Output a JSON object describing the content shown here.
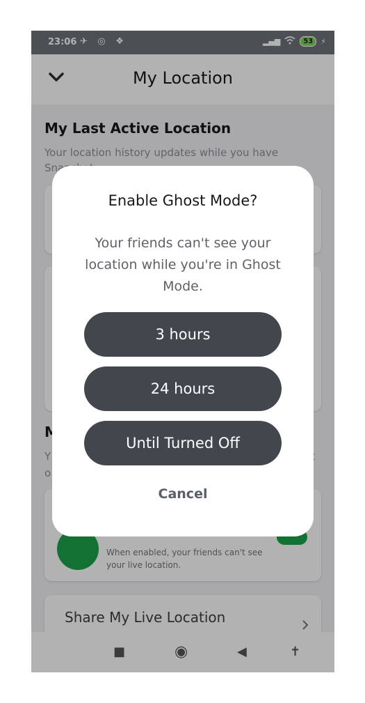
{
  "status_bar": {
    "time": "23:06",
    "left_icons": "✈ ◎ ❖",
    "signal": "▂▄▆",
    "wifi": "wifi",
    "battery": "53",
    "charging": "⚡"
  },
  "header": {
    "title": "My Location",
    "back_icon": "chevron-down-icon"
  },
  "last_active": {
    "title": "My Last Active Location",
    "subtitle": "Your location history updates while you have Snapchat"
  },
  "ghost_section": {
    "title": "M",
    "subtitle_left": "Y",
    "subtitle_right": "'t",
    "subtitle_line2": "o",
    "description": "When enabled, your friends can't see your live location."
  },
  "share_live": {
    "label": "Share My Live Location"
  },
  "dialog": {
    "title": "Enable Ghost Mode?",
    "body": "Your friends can't see your location while you're in Ghost Mode.",
    "options": [
      "3 hours",
      "24 hours",
      "Until Turned Off"
    ],
    "cancel": "Cancel"
  },
  "navbar": {
    "recents": "■",
    "home": "◉",
    "back": "◀",
    "accessibility": "✝"
  },
  "colors": {
    "accent_green": "#1aa34a",
    "button_dark": "#42464d",
    "overlay": "rgba(0,0,0,0.30)"
  }
}
